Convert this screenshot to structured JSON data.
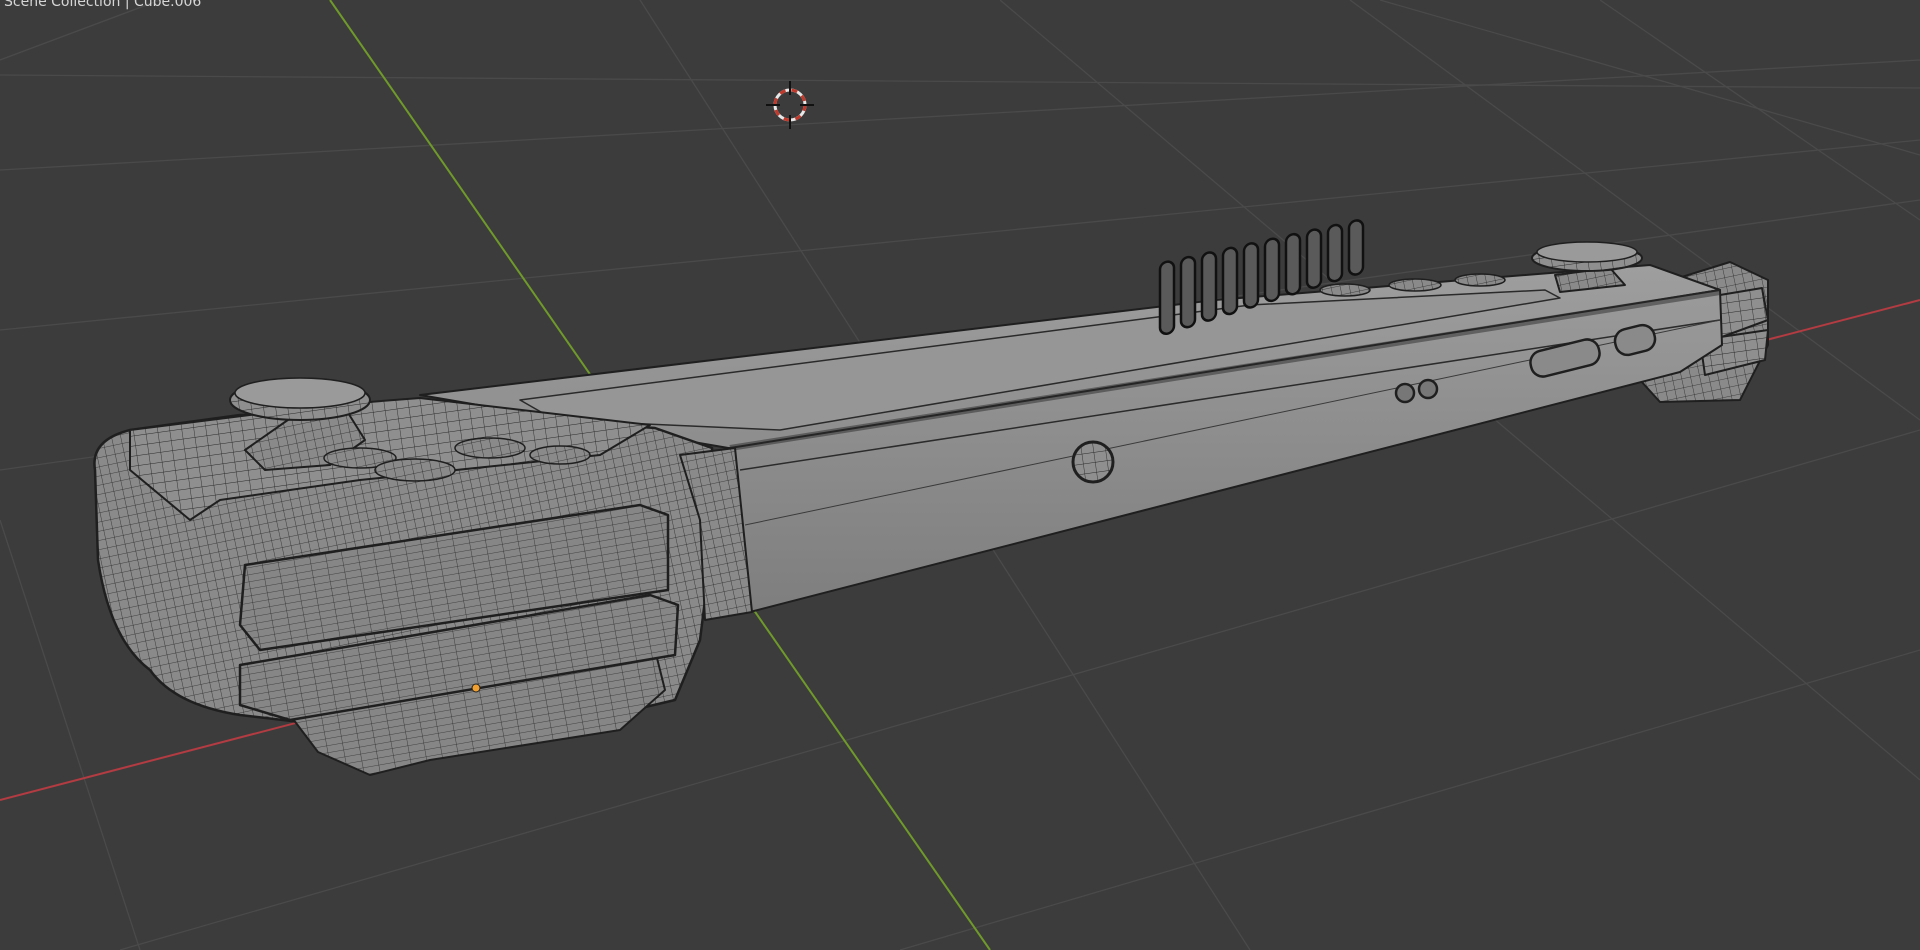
{
  "viewport": {
    "overlay_text": "Scene Collection | Cube.006",
    "background_color": "#3c3c3c",
    "grid_color": "#4a4a4a",
    "x_axis_color": "#b33b42",
    "y_axis_color": "#6f9a2a"
  },
  "scene": {
    "object_name": "Cube.006",
    "object_description": "handheld game console wireframe mesh",
    "mesh_color": "#8c8c8c",
    "edge_color": "#1e1e1e",
    "origin_color": "#f0a030",
    "cursor_icon": "3d-cursor-icon"
  }
}
